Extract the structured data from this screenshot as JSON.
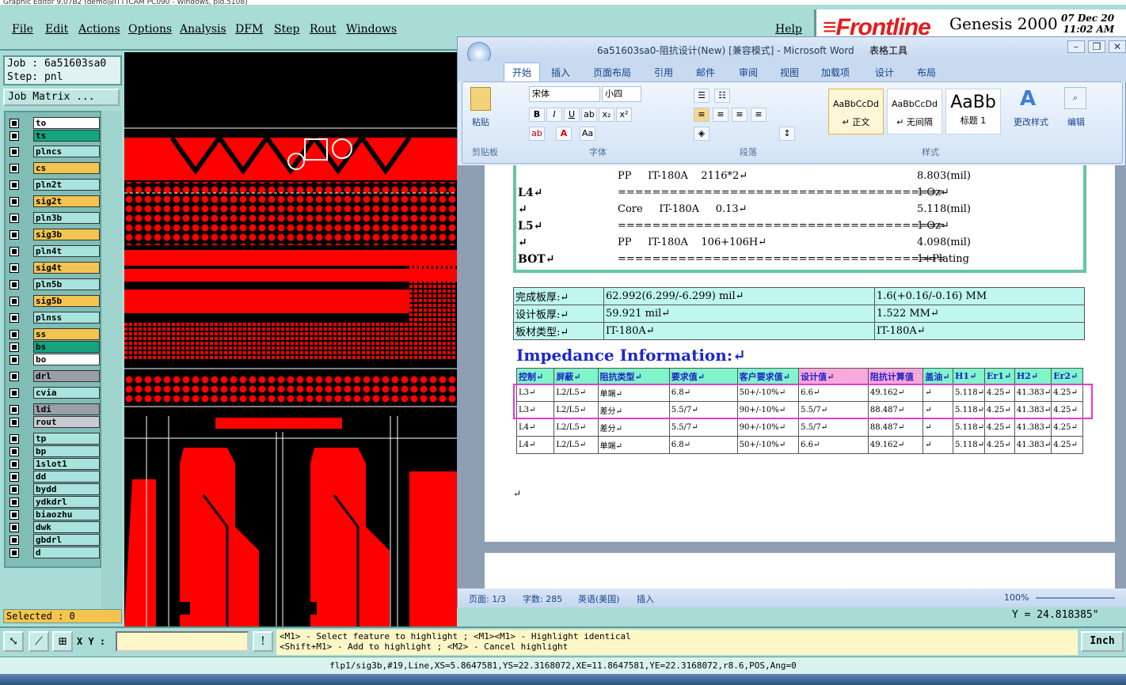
{
  "genesis": {
    "title": "Graphic Editor 9.07B2 (demo@ITTTCAM PC090 - Windows, pid.5108)",
    "menu": [
      "File",
      "Edit",
      "Actions",
      "Options",
      "Analysis",
      "DFM",
      "Step",
      "Rout",
      "Windows"
    ],
    "help": "Help",
    "logo_front": "Frontline",
    "product": "Genesis 2000",
    "date": "07 Dec 20",
    "time": "11:02 AM",
    "job": "Job : 6a51603sa0",
    "step": "Step: pnl",
    "job_matrix": "Job Matrix ...",
    "layers": [
      {
        "name": "to",
        "color": "#ffffff"
      },
      {
        "name": "ts",
        "color": "#14a57e"
      },
      {
        "name": "plncs",
        "color": "#a8e3de"
      },
      {
        "name": "cs",
        "color": "#f3c550"
      },
      {
        "name": "pln2t",
        "color": "#a8e3de"
      },
      {
        "name": "sig2t",
        "color": "#f3c550"
      },
      {
        "name": "pln3b",
        "color": "#a8e3de"
      },
      {
        "name": "sig3b",
        "color": "#f3c550"
      },
      {
        "name": "pln4t",
        "color": "#a8e3de"
      },
      {
        "name": "sig4t",
        "color": "#f3c550"
      },
      {
        "name": "pln5b",
        "color": "#a8e3de"
      },
      {
        "name": "sig5b",
        "color": "#f3c550"
      },
      {
        "name": "plnss",
        "color": "#a8e3de"
      },
      {
        "name": "ss",
        "color": "#f3c550"
      },
      {
        "name": "bs",
        "color": "#14a57e"
      },
      {
        "name": "bo",
        "color": "#ffffff"
      },
      {
        "name": "drl",
        "color": "#9a9ea8"
      },
      {
        "name": "cvia",
        "color": "#a8e3de"
      },
      {
        "name": "ldi",
        "color": "#9a9ea8"
      },
      {
        "name": "rout",
        "color": "#c8ccd2"
      },
      {
        "name": "tp",
        "color": "#a8e3de"
      },
      {
        "name": "bp",
        "color": "#a8e3de"
      },
      {
        "name": "1slot1",
        "color": "#a8e3de"
      },
      {
        "name": "dd",
        "color": "#a8e3de"
      },
      {
        "name": "bydd",
        "color": "#a8e3de"
      },
      {
        "name": "ydkdrl",
        "color": "#a8e3de"
      },
      {
        "name": "biaozhu",
        "color": "#a8e3de"
      },
      {
        "name": "dwk",
        "color": "#a8e3de"
      },
      {
        "name": "gbdrl",
        "color": "#a8e3de"
      },
      {
        "name": "d",
        "color": "#a8e3de"
      }
    ],
    "selected": "Selected : 0",
    "coord_y": "Y = 24.818385\"",
    "xy_label": "X Y :",
    "msg1": "<M1> - Select feature to highlight ; <M1><M1> - Highlight identical",
    "msg2": "<Shift+M1> - Add to highlight ; <M2> - Cancel highlight",
    "units": "Inch",
    "status": "flp1/sig3b,#19,Line,XS=5.8647581,YS=22.3168072,XE=11.8647581,YE=22.3168072,r8.6,POS,Ang=0"
  },
  "word": {
    "title": "6a51603sa0-阻抗设计(New) [兼容模式] - Microsoft Word",
    "context_tab": "表格工具",
    "tabs": [
      "开始",
      "插入",
      "页面布局",
      "引用",
      "邮件",
      "审阅",
      "视图",
      "加载项",
      "设计",
      "布局"
    ],
    "font_name": "宋体",
    "font_size": "小四",
    "groups": {
      "clipboard": "剪贴板",
      "font": "字体",
      "paragraph": "段落",
      "styles": "样式"
    },
    "paste": "粘贴",
    "styles": [
      {
        "preview": "AaBbCcDd",
        "name": "↵ 正文"
      },
      {
        "preview": "AaBbCcDd",
        "name": "↵ 无间隔"
      },
      {
        "preview": "AaBb",
        "name": "标题 1"
      }
    ],
    "change_styles": "更改样式",
    "edit": "编辑",
    "stackup": [
      {
        "label": "",
        "mat": "PP     IT-180A    2116*2↵",
        "val": "8.803(mil)"
      },
      {
        "label": "L4↵",
        "mat": "======================================",
        "val": "1 Oz↵"
      },
      {
        "label": "↵",
        "mat": "Core     IT-180A     0.13↵",
        "val": "5.118(mil)"
      },
      {
        "label": "L5↵",
        "mat": "======================================",
        "val": "1 Oz↵"
      },
      {
        "label": "↵",
        "mat": "PP     IT-180A    106+106H↵",
        "val": "4.098(mil)"
      },
      {
        "label": "BOT↵",
        "mat": "======================================",
        "val": "1+Plating"
      }
    ],
    "thickness": [
      [
        "完成板厚:↵",
        "62.992(6.299/-6.299) mil↵",
        "1.6(+0.16/-0.16) MM"
      ],
      [
        "设计板厚:↵",
        "59.921 mil↵",
        "1.522 MM↵"
      ],
      [
        "板材类型:↵",
        "IT-180A↵",
        "IT-180A↵"
      ]
    ],
    "impedance_title": "Impedance Information:↵",
    "imp_headers": [
      "控制↵",
      "屏蔽↵",
      "阻抗类型↵",
      "要求值↵",
      "客户要求值↵",
      "设计值↵",
      "阻抗计算值",
      "盖油↵",
      "H1↵",
      "Er1↵",
      "H2↵",
      "Er2↵"
    ],
    "imp_rows": [
      [
        "L3↵",
        "L2/L5↵",
        "单端↵",
        "6.8↵",
        "50+/-10%↵",
        "6.6↵",
        "49.162↵",
        "↵",
        "5.118↵",
        "4.25↵",
        "41.383↵",
        "4.25↵"
      ],
      [
        "L3↵",
        "L2/L5↵",
        "差分↵",
        "5.5/7↵",
        "90+/-10%↵",
        "5.5/7↵",
        "88.487↵",
        "↵",
        "5.118↵",
        "4.25↵",
        "41.383↵",
        "4.25↵"
      ],
      [
        "L4↵",
        "L2/L5↵",
        "差分↵",
        "5.5/7↵",
        "90+/-10%↵",
        "5.5/7↵",
        "88.487↵",
        "↵",
        "5.118↵",
        "4.25↵",
        "41.383↵",
        "4.25↵"
      ],
      [
        "L4↵",
        "L2/L5↵",
        "单端↵",
        "6.8↵",
        "50+/-10%↵",
        "6.6↵",
        "49.162↵",
        "↵",
        "5.118↵",
        "4.25↵",
        "41.383↵",
        "4.25↵"
      ]
    ],
    "status": {
      "page": "页面: 1/3",
      "words": "字数: 285",
      "lang": "英语(美国)",
      "mode": "插入",
      "zoom": "100%"
    }
  }
}
